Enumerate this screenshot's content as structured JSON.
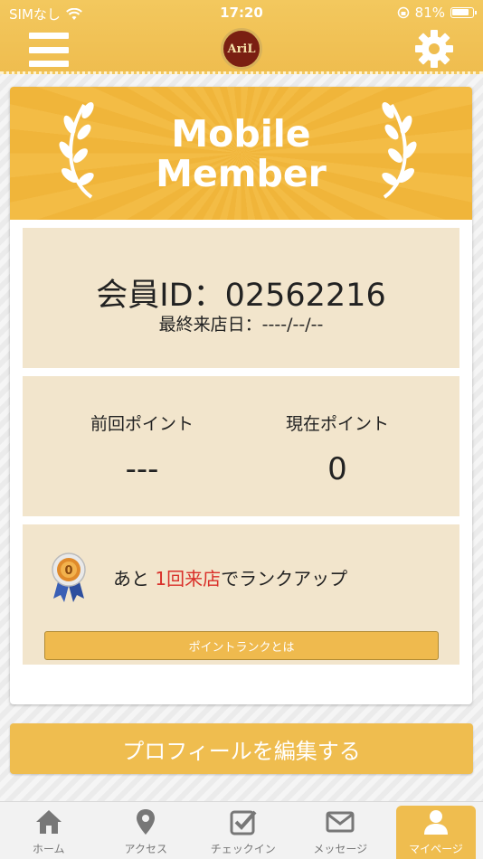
{
  "status_bar": {
    "carrier": "SIMなし",
    "time": "17:20",
    "battery": "81%"
  },
  "header": {
    "logo_text": "AriL",
    "menu_icon": "hamburger-menu-icon",
    "settings_icon": "gear-icon"
  },
  "member_card": {
    "banner_title_line1": "Mobile",
    "banner_title_line2": "Member",
    "member_id_label": "会員ID：",
    "member_id": "02562216",
    "last_visit_label": "最終来店日：",
    "last_visit": "----/--/--",
    "previous_points_label": "前回ポイント",
    "previous_points": "---",
    "current_points_label": "現在ポイント",
    "current_points": "0",
    "rank_prefix": "あと ",
    "rank_highlight": "1回来店",
    "rank_suffix": "でランクアップ",
    "rank_info_button": "ポイントランクとは"
  },
  "edit_profile_button": "プロフィールを編集する",
  "tabs": [
    {
      "label": "ホーム",
      "icon": "home-icon"
    },
    {
      "label": "アクセス",
      "icon": "map-pin-icon"
    },
    {
      "label": "チェックイン",
      "icon": "checkbox-icon"
    },
    {
      "label": "メッセージ",
      "icon": "envelope-icon"
    },
    {
      "label": "マイページ",
      "icon": "user-icon",
      "active": true
    }
  ],
  "colors": {
    "accent": "#efbd4f",
    "panel": "#f2e5cc",
    "highlight": "#d9302a"
  }
}
